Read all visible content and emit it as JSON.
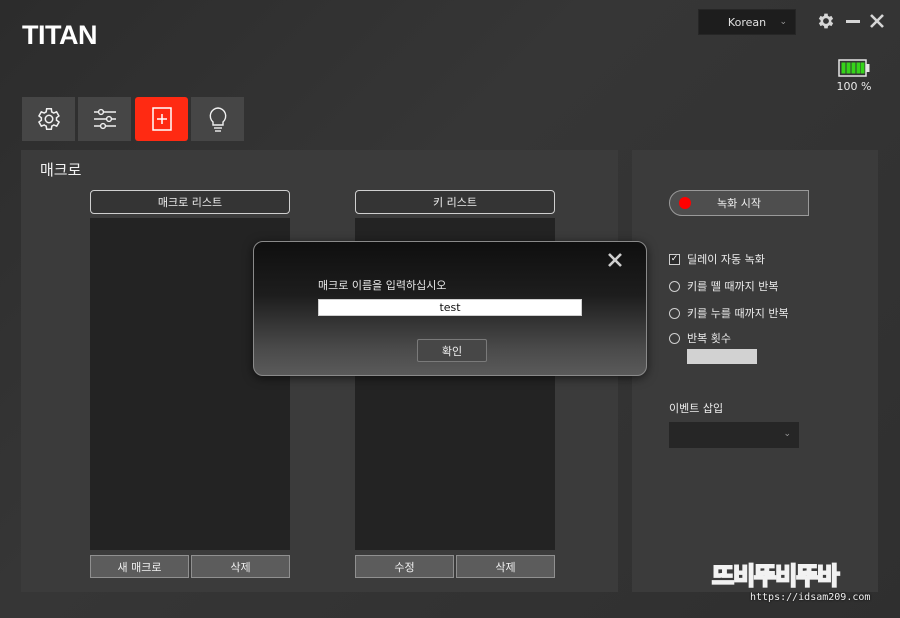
{
  "app": {
    "logo": "TITAN"
  },
  "header": {
    "language": "Korean",
    "battery_text": "100 %",
    "battery_level": 1.0
  },
  "tabs": [
    {
      "icon": "gear-icon",
      "active": false
    },
    {
      "icon": "sliders-icon",
      "active": false
    },
    {
      "icon": "macro-add-icon",
      "active": true
    },
    {
      "icon": "bulb-icon",
      "active": false
    }
  ],
  "main": {
    "title": "매크로",
    "macro_list": {
      "header": "매크로 리스트",
      "new_label": "새 매크로",
      "delete_label": "삭제"
    },
    "key_list": {
      "header": "키 리스트",
      "edit_label": "수정",
      "delete_label": "삭제"
    }
  },
  "right": {
    "record_label": "녹화 시작",
    "options": {
      "delay_auto": {
        "label": "딜레이 자동 녹화",
        "checked": true
      },
      "repeat_release": "키를 뗄 때까지 반복",
      "repeat_press": "키를 누를 때까지 반복",
      "repeat_count": "반복 횟수"
    },
    "repeat_count_value": "",
    "event_insert_label": "이벤트 삽입",
    "event_insert_value": ""
  },
  "dialog": {
    "prompt": "매크로 이름을 입력하십시오",
    "input_value": "test",
    "ok_label": "확인"
  },
  "watermark": {
    "text": "뜨비뚜비뚜바",
    "url": "https://idsam209.com"
  },
  "colors": {
    "accent": "#ff2a12",
    "record": "#ff0000",
    "battery": "#35d41a"
  }
}
